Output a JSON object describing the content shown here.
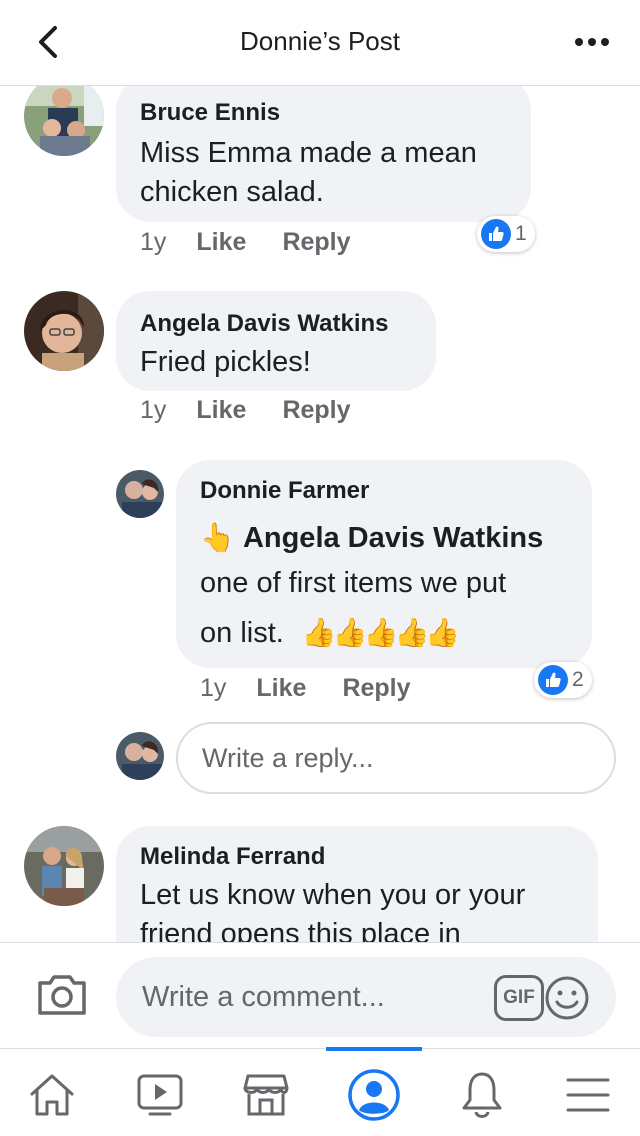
{
  "header": {
    "title": "Donnie’s Post"
  },
  "comments": [
    {
      "author": "Bruce Ennis",
      "text_lines": [
        "Miss Emma made a mean",
        "chicken salad."
      ],
      "time": "1y",
      "like_label": "Like",
      "reply_label": "Reply",
      "reaction_count": "1"
    },
    {
      "author": "Angela Davis Watkins",
      "text_lines": [
        "Fried pickles!"
      ],
      "time": "1y",
      "like_label": "Like",
      "reply_label": "Reply"
    },
    {
      "author": "Donnie Farmer",
      "mention": "Angela Davis Watkins",
      "text_lines": [
        "one of first items we put",
        "on list."
      ],
      "emoji": "👍👍👍👍👍",
      "mention_emoji": "👆",
      "time": "1y",
      "like_label": "Like",
      "reply_label": "Reply",
      "reaction_count": "2"
    },
    {
      "author": "Melinda Ferrand",
      "text_lines": [
        "Let us know when you or your",
        "friend opens this place in"
      ]
    }
  ],
  "reply_input": {
    "placeholder": "Write a reply..."
  },
  "composer": {
    "placeholder": "Write a comment...",
    "gif_label": "GIF"
  },
  "tabs": [
    {
      "icon": "home-icon"
    },
    {
      "icon": "video-icon"
    },
    {
      "icon": "marketplace-icon"
    },
    {
      "icon": "profile-icon",
      "active": true
    },
    {
      "icon": "notifications-icon"
    },
    {
      "icon": "menu-icon"
    }
  ],
  "colors": {
    "accent": "#1877f2",
    "bubble": "#f0f2f5",
    "secondary_text": "#65676b"
  }
}
